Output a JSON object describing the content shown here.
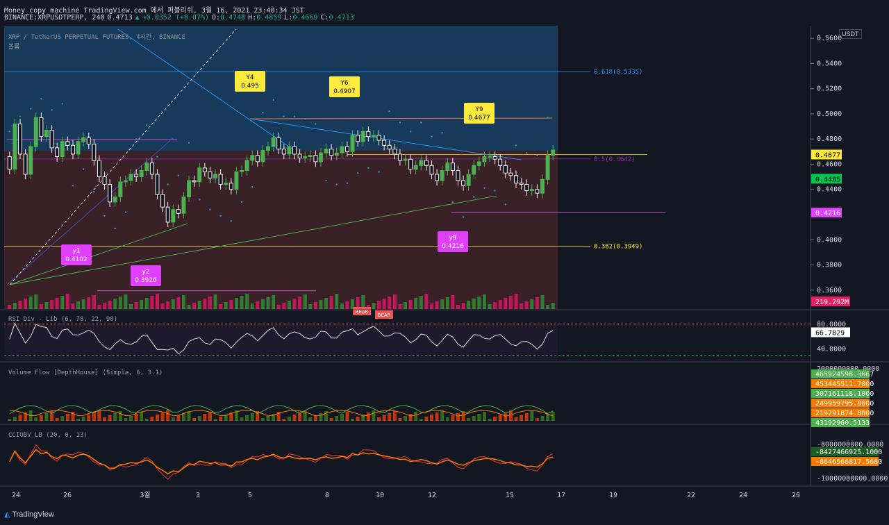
{
  "header": {
    "line1": "Money_copy_machine TradingView.com 에서 퍼블리쉬, 3월 16, 2021 23:40:34 JST",
    "symbol": "BINANCE:XRPUSDTPERP, 240",
    "last": "0.4713",
    "change": "+0.0352 (+8.07%)",
    "open_label": "O:",
    "open": "0.4748",
    "high_label": "H:",
    "high": "0.4859",
    "low_label": "L:",
    "low": "0.4669",
    "close_label": "C:",
    "close": "0.4713"
  },
  "pane_title": "XRP / TetherUS PERPETUAL FUTURES, 4시간, BINANCE",
  "pane_subtitle": "볼륨",
  "currency_badge": "USDT",
  "footer": "TradingView",
  "chart_data": [
    {
      "type": "candlestick",
      "title": "XRP / TetherUS PERPETUAL FUTURES, 4시간, BINANCE",
      "ylim": [
        0.345,
        0.57
      ],
      "y_ticks": [
        "0.5600",
        "0.5400",
        "0.5200",
        "0.5000",
        "0.4800",
        "0.4600",
        "0.4400",
        "0.4200",
        "0.4000",
        "0.3800",
        "0.3600"
      ],
      "y_tick_values": [
        0.56,
        0.54,
        0.52,
        0.5,
        0.48,
        0.46,
        0.44,
        0.42,
        0.4,
        0.38,
        0.36
      ],
      "x_ticks": [
        "24",
        "26",
        "3월",
        "3",
        "5",
        "8",
        "10",
        "12",
        "15",
        "17",
        "19",
        "22",
        "24",
        "26"
      ],
      "close_series": [
        0.456,
        0.492,
        0.468,
        0.452,
        0.474,
        0.497,
        0.482,
        0.487,
        0.473,
        0.466,
        0.478,
        0.475,
        0.468,
        0.478,
        0.481,
        0.476,
        0.463,
        0.45,
        0.444,
        0.43,
        0.434,
        0.446,
        0.447,
        0.452,
        0.45,
        0.455,
        0.461,
        0.452,
        0.436,
        0.426,
        0.414,
        0.424,
        0.421,
        0.434,
        0.447,
        0.446,
        0.457,
        0.454,
        0.449,
        0.452,
        0.444,
        0.445,
        0.44,
        0.454,
        0.455,
        0.463,
        0.467,
        0.462,
        0.471,
        0.474,
        0.481,
        0.472,
        0.468,
        0.474,
        0.468,
        0.465,
        0.466,
        0.467,
        0.462,
        0.469,
        0.472,
        0.467,
        0.469,
        0.474,
        0.47,
        0.483,
        0.478,
        0.486,
        0.482,
        0.483,
        0.479,
        0.475,
        0.472,
        0.468,
        0.463,
        0.464,
        0.456,
        0.459,
        0.463,
        0.459,
        0.452,
        0.447,
        0.455,
        0.461,
        0.455,
        0.447,
        0.443,
        0.452,
        0.459,
        0.462,
        0.466,
        0.466,
        0.464,
        0.459,
        0.453,
        0.451,
        0.445,
        0.444,
        0.439,
        0.44,
        0.437,
        0.448,
        0.467,
        0.4713
      ],
      "annotations": [
        {
          "text": "Y4",
          "value": "0.495"
        },
        {
          "text": "Y6",
          "value": "0.4907"
        },
        {
          "text": "Y9",
          "value": "0.4677"
        },
        {
          "text": "y1",
          "value": "0.4102"
        },
        {
          "text": "y2",
          "value": "0.3926"
        },
        {
          "text": "y9",
          "value": "0.4216"
        }
      ],
      "fib_levels": [
        {
          "label": "0.618(0.5335)",
          "value": 0.5335,
          "color": "#2196f3"
        },
        {
          "label": "0.5(0.4642)",
          "value": 0.4642,
          "color": "#9c27b0"
        },
        {
          "label": "0.382(0.3949)",
          "value": 0.3949,
          "color": "#ffeb3b"
        }
      ],
      "price_labels": [
        {
          "text": "0.4677",
          "value": 0.4677,
          "bg": "#ffeb3b",
          "fg": "#000000"
        },
        {
          "text": "0.4485",
          "value": 0.4485,
          "bg": "#00c853",
          "fg": "#000000"
        },
        {
          "text": "0.4216",
          "value": 0.4216,
          "bg": "#e040fb",
          "fg": "#ffffff"
        }
      ],
      "volume_label": "219.292M",
      "signals": [
        "BEAR",
        "BEAR"
      ]
    },
    {
      "type": "line",
      "title": "RSI Div - Lib (6, 78, 22, 90)",
      "ylim": [
        20,
        100
      ],
      "y_ticks": [
        "80.0000",
        "40.0000"
      ],
      "current": "66.7829"
    },
    {
      "type": "bar",
      "title": "Volume Flow [DepthHouse] (Simple, 6, 3.1)",
      "y_ticks": [
        "2000000000.0000"
      ],
      "labels": [
        {
          "text": "465924598.3667",
          "bg": "#4caf50"
        },
        {
          "text": "453445511.7000",
          "bg": "#f57c00"
        },
        {
          "text": "307161118.1000",
          "bg": "#4caf50"
        },
        {
          "text": "249959795.8000",
          "bg": "#f57c00"
        },
        {
          "text": "219291874.8000",
          "bg": "#f57c00"
        },
        {
          "text": "43192960.5133",
          "bg": "#4caf50"
        }
      ]
    },
    {
      "type": "line",
      "title": "CCIOBV_LB (20, 0, 13)",
      "y_ticks": [
        "-8000000000.0000",
        "-10000000000.0000"
      ],
      "labels": [
        {
          "text": "-8427466925.1000",
          "bg": "#1b5e20"
        },
        {
          "text": "-8646566817.5680",
          "bg": "#f57c00"
        }
      ]
    }
  ],
  "colors": {
    "background": "#131722",
    "up": "#4caf50",
    "down": "#ef5350",
    "grid": "#1e222d"
  }
}
